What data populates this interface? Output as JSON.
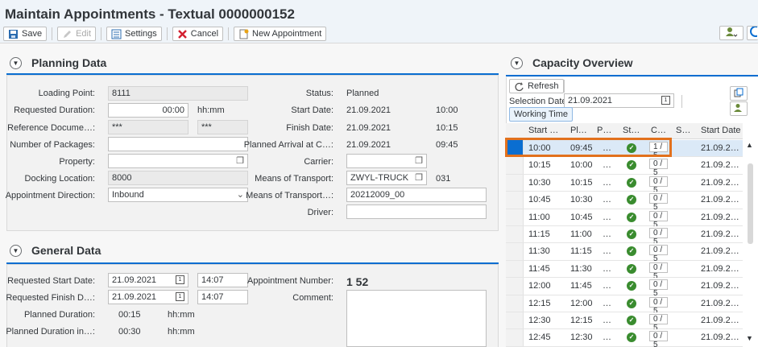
{
  "window": {
    "title": "Maintain Appointments - Textual 0000000152"
  },
  "toolbar": {
    "save": "Save",
    "edit": "Edit",
    "settings": "Settings",
    "cancel": "Cancel",
    "new_appointment": "New Appointment"
  },
  "planning": {
    "header": "Planning Data",
    "loading_point_label": "Loading Point:",
    "loading_point": "8111",
    "requested_duration_label": "Requested Duration:",
    "requested_duration": "00:00",
    "duration_unit": "hh:mm",
    "reference_doc_label": "Reference Docume…:",
    "reference_doc_1": "***",
    "reference_doc_2": "***",
    "packages_label": "Number of Packages:",
    "packages": "",
    "property_label": "Property:",
    "property": "",
    "docking_label": "Docking Location:",
    "docking": "8000",
    "direction_label": "Appointment Direction:",
    "direction": "Inbound",
    "status_label": "Status:",
    "status": "Planned",
    "start_date_label": "Start Date:",
    "start_date": "21.09.2021",
    "start_time": "10:00",
    "finish_date_label": "Finish Date:",
    "finish_date": "21.09.2021",
    "finish_time": "10:15",
    "planned_arrival_label": "Planned Arrival at C…:",
    "planned_arrival_date": "21.09.2021",
    "planned_arrival_time": "09:45",
    "carrier_label": "Carrier:",
    "carrier": "",
    "means_label": "Means of Transport:",
    "means": "ZWYL-TRUCK",
    "means_code": "031",
    "means2_label": "Means of Transport…:",
    "means2": "20212009_00",
    "driver_label": "Driver:",
    "driver": ""
  },
  "general": {
    "header": "General Data",
    "req_start_label": "Requested Start Date:",
    "req_start_date": "21.09.2021",
    "req_start_time": "14:07",
    "req_finish_label": "Requested Finish D…:",
    "req_finish_date": "21.09.2021",
    "req_finish_time": "14:07",
    "planned_duration_label": "Planned Duration:",
    "planned_duration": "00:15",
    "planned_duration_unit": "hh:mm",
    "planned_duration_in_label": "Planned Duration in…:",
    "planned_duration_in": "00:30",
    "planned_duration_in_unit": "hh:mm",
    "appointment_number_label": "Appointment Number:",
    "appointment_number": "1 52",
    "comment_label": "Comment:",
    "comment": ""
  },
  "capacity": {
    "header": "Capacity Overview",
    "refresh": "Refresh",
    "selection_date_label": "Selection Date:",
    "selection_date": "21.09.2021",
    "working_time": "Working Time",
    "columns": [
      "Start …",
      "Pl…",
      "P…",
      "St…",
      "C…",
      "S…",
      "Start Date"
    ],
    "rows": [
      {
        "start": "10:00",
        "planned": "09:45",
        "p": "…",
        "cap": "1 / 5",
        "date": "21.09.2…"
      },
      {
        "start": "10:15",
        "planned": "10:00",
        "p": "…",
        "cap": "0 / 5",
        "date": "21.09.2…"
      },
      {
        "start": "10:30",
        "planned": "10:15",
        "p": "…",
        "cap": "0 / 5",
        "date": "21.09.2…"
      },
      {
        "start": "10:45",
        "planned": "10:30",
        "p": "…",
        "cap": "0 / 5",
        "date": "21.09.2…"
      },
      {
        "start": "11:00",
        "planned": "10:45",
        "p": "…",
        "cap": "0 / 5",
        "date": "21.09.2…"
      },
      {
        "start": "11:15",
        "planned": "11:00",
        "p": "…",
        "cap": "0 / 5",
        "date": "21.09.2…"
      },
      {
        "start": "11:30",
        "planned": "11:15",
        "p": "…",
        "cap": "0 / 5",
        "date": "21.09.2…"
      },
      {
        "start": "11:45",
        "planned": "11:30",
        "p": "…",
        "cap": "0 / 5",
        "date": "21.09.2…"
      },
      {
        "start": "12:00",
        "planned": "11:45",
        "p": "…",
        "cap": "0 / 5",
        "date": "21.09.2…"
      },
      {
        "start": "12:15",
        "planned": "12:00",
        "p": "…",
        "cap": "0 / 5",
        "date": "21.09.2…"
      },
      {
        "start": "12:30",
        "planned": "12:15",
        "p": "…",
        "cap": "0 / 5",
        "date": "21.09.2…"
      },
      {
        "start": "12:45",
        "planned": "12:30",
        "p": "…",
        "cap": "0 / 5",
        "date": "21.09.2…"
      }
    ]
  },
  "colors": {
    "accent": "#0a6ed1",
    "highlight": "#e2711d",
    "ok": "#3a8c2f"
  },
  "icons": [
    "save-icon",
    "edit-icon",
    "settings-icon",
    "cancel-icon",
    "new-appointment-icon",
    "refresh-icon",
    "calendar-icon",
    "status-ok-icon"
  ]
}
